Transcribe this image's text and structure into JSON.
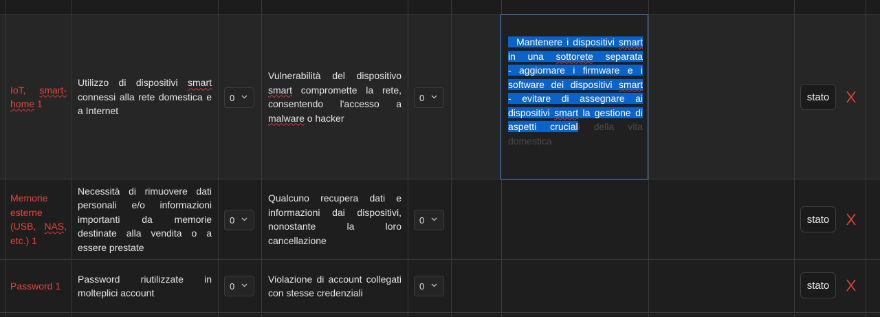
{
  "rows": [
    {
      "label": "IoT, smart-home 1",
      "description": "Utilizzo di dispositivi smart connessi alla rete domestica e a Internet",
      "select1": "0",
      "threat": "Vulnerabilità del dispositivo smart compromette la rete, consentendo l'accesso a malware o hacker",
      "select2": "0",
      "measures_selected": "Mantenere i dispositivi smart in una sottorete separata - aggiornare i firmware e i software dei dispositivi smart - evitare di assegnare ai dispositivi smart la gestione di aspetti crucial",
      "measures_unselected": "i della vita domestica",
      "button": "stato",
      "delete_icon": "x-icon"
    },
    {
      "label": "Memorie esterne (USB, NAS, etc.) 1",
      "description": "Necessità di rimuovere dati personali e/o informazioni importanti da memorie destinate alla vendita o a essere prestate",
      "select1": "0",
      "threat": "Qualcuno recupera dati e informazioni dai dispositivi, nonostante la loro cancellazione",
      "select2": "0",
      "button": "stato",
      "delete_icon": "x-icon"
    },
    {
      "label": "Password 1",
      "description": "Password riutilizzate in molteplici account",
      "select1": "0",
      "threat": "Violazione di account collegati con stesse credenziali",
      "select2": "0",
      "button": "stato",
      "delete_icon": "x-icon"
    }
  ],
  "colors": {
    "label_red": "#e8443a",
    "selection_blue": "#0a63c9",
    "focus_border": "#4d8fd6"
  }
}
